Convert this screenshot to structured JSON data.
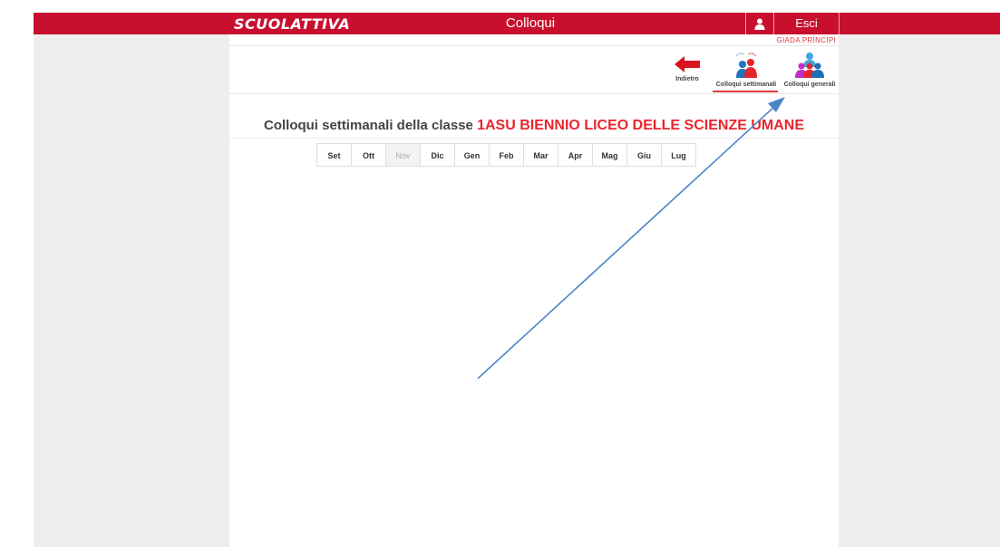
{
  "app": {
    "logo": "SCUOLATTIVA",
    "title": "Colloqui",
    "logout_label": "Esci",
    "user_name": "GIADA PRINCIPI"
  },
  "toolbar": {
    "back_label": "Indietro",
    "weekly_label": "Colloqui settimanali",
    "general_label": "Colloqui generali",
    "active": "weekly"
  },
  "main": {
    "heading_prefix": "Colloqui settimanali della classe",
    "class_name": "1ASU BIENNIO LICEO DELLE SCIENZE UMANE",
    "months": [
      {
        "label": "Set",
        "enabled": true
      },
      {
        "label": "Ott",
        "enabled": true
      },
      {
        "label": "Nov",
        "enabled": false
      },
      {
        "label": "Dic",
        "enabled": true
      },
      {
        "label": "Gen",
        "enabled": true
      },
      {
        "label": "Feb",
        "enabled": true
      },
      {
        "label": "Mar",
        "enabled": true
      },
      {
        "label": "Apr",
        "enabled": true
      },
      {
        "label": "Mag",
        "enabled": true
      },
      {
        "label": "Giu",
        "enabled": true
      },
      {
        "label": "Lug",
        "enabled": true
      }
    ]
  },
  "colors": {
    "brand_red": "#c8102e",
    "accent_red": "#e8262e",
    "annotation_arrow": "#4a86c8"
  },
  "icons": {
    "user": "user-icon",
    "back": "arrow-left-icon",
    "weekly": "weekly-meetings-icon",
    "general": "general-meetings-icon"
  }
}
